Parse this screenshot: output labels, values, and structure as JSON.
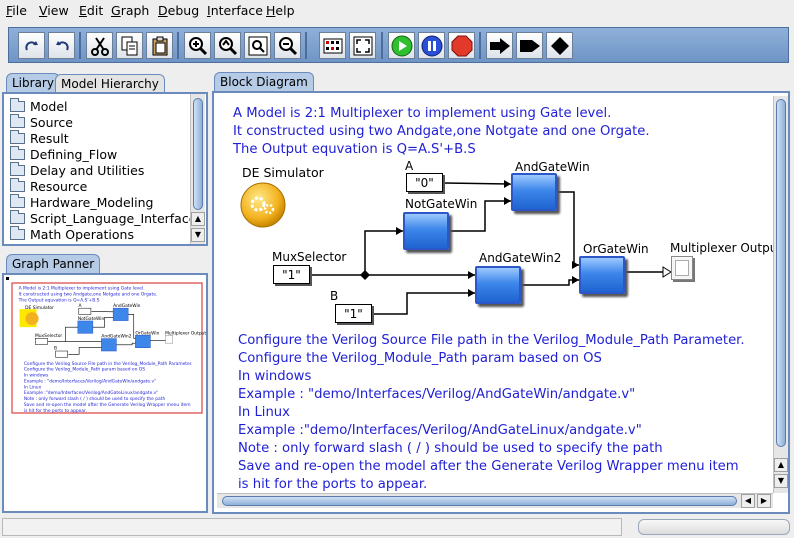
{
  "menu": {
    "file": "ile",
    "file_u": "F",
    "view": "iew",
    "view_u": "V",
    "edit": "dit",
    "edit_u": "E",
    "graph": "raph",
    "graph_u": "G",
    "debug": "ebug",
    "debug_u": "D",
    "interface": "nterface",
    "interface_u": "I",
    "help": "elp",
    "help_u": "H"
  },
  "tabs": {
    "library": "Library",
    "model_hierarchy": "Model Hierarchy",
    "graph_panner": "Graph Panner",
    "block_diagram": "Block Diagram"
  },
  "library": {
    "items": [
      {
        "label": "Model"
      },
      {
        "label": "Source"
      },
      {
        "label": "Result"
      },
      {
        "label": "Defining_Flow"
      },
      {
        "label": "Delay and Utilities"
      },
      {
        "label": "Resource"
      },
      {
        "label": "Hardware_Modeling"
      },
      {
        "label": "Script_Language_Interface"
      },
      {
        "label": "Math Operations"
      }
    ]
  },
  "diagram": {
    "header_lines": [
      "A Model is 2:1 Multiplexer to implement using Gate level.",
      "It constructed using two Andgate,one Notgate and one Orgate.",
      "The Output equvation is Q=A.S'+B.S"
    ],
    "director": "DE Simulator",
    "labels": {
      "a": "A",
      "b": "B",
      "mux_selector": "MuxSelector",
      "and_gate_win": "AndGateWin",
      "not_gate_win": "NotGateWin",
      "and_gate_win2": "AndGateWin2",
      "or_gate_win": "OrGateWin",
      "mux_output": "Multiplexer Output"
    },
    "constants": {
      "a_value": "\"0\"",
      "sel_value": "\"1\"",
      "b_value": "\"1\""
    },
    "notes": [
      "Configure the Verilog Source File path in the Verilog_Module_Path Parameter.",
      "Configure the Verilog_Module_Path param based on OS",
      "In windows",
      "Example :  \"demo/Interfaces/Verilog/AndGateWin/andgate.v\"",
      "In Linux",
      "Example :\"demo/Interfaces/Verilog/AndGateLinux/andgate.v\"",
      "Note    :   only forward slash ( / ) should be used to specify the path",
      "Save and re-open the model after the Generate Verilog Wrapper menu item",
      "is hit for the ports to appear."
    ]
  },
  "panner_preview": {
    "header_lines": [
      "A Model is 2:1 Multiplexer to implement using Gate level.",
      "It constructed using two Andgate,one Notgate and one Orgate.",
      "The Output equvation is Q=A.S'+B.S"
    ],
    "director": "DE Simulator",
    "labels": {
      "and_gate_win": "AndGateWin",
      "not_gate_win": "NotGateWin",
      "and_gate_win2": "AndGateWin2",
      "or_gate_win": "OrGateWin",
      "mux_output": "Multiplexer Output",
      "mux_selector": "MuxSelector",
      "a": "A",
      "b": "B"
    },
    "notes": [
      "Configure the Verilog Source File path in the Verilog_Module_Path Parameter.",
      "Configure the Verilog_Module_Path param based on OS",
      "In windows",
      "Example :  \"demo/Interfaces/Verilog/AndGateWin/andgate.v\"",
      "In Linux",
      "Example :\"demo/Interfaces/Verilog/AndGateLinux/andgate.v\"",
      "Note    :   only forward slash ( / ) should be used to specify the path",
      "Save and re-open the model after the Generate Verilog Wrapper menu item",
      "is hit for the ports to appear."
    ]
  },
  "colors": {
    "accent": "#6a8bbb",
    "diagram_text": "#1f1fd6",
    "actor_blue": "#3d86ea",
    "run_green": "#2fbf2f",
    "pause_blue": "#2a4fd8",
    "stop_red": "#e23a2a",
    "panner_frame": "#d01818"
  },
  "icons": [
    "redo-icon",
    "undo-icon",
    "cut-icon",
    "copy-icon",
    "paste-icon",
    "zoom-in-icon",
    "zoom-reset-icon",
    "zoom-fit-icon",
    "zoom-out-icon",
    "automatic-layout-icon",
    "full-screen-icon",
    "run-icon",
    "pause-icon",
    "stop-icon",
    "port-icon",
    "port-bus-icon",
    "relation-icon"
  ]
}
